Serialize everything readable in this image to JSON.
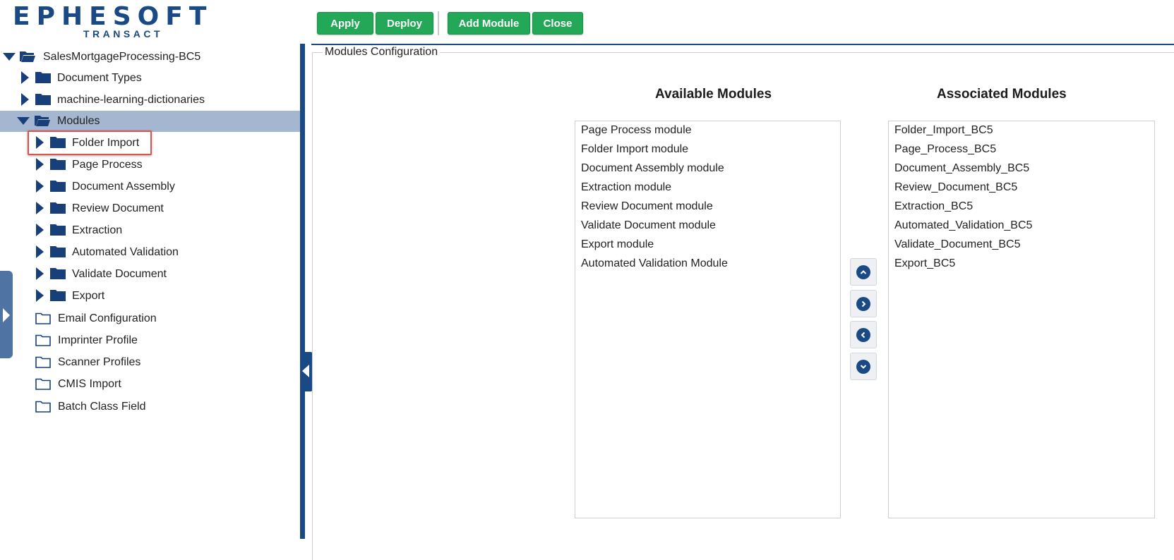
{
  "brand": {
    "name": "EPHESOFT",
    "sub": "TRANSACT"
  },
  "toolbar": {
    "apply": "Apply",
    "deploy": "Deploy",
    "add_module": "Add Module",
    "close": "Close"
  },
  "tree": {
    "root": "SalesMortgageProcessing-BC5",
    "document_types": "Document Types",
    "ml_dictionaries": "machine-learning-dictionaries",
    "modules": "Modules",
    "module_items": [
      "Folder Import",
      "Page Process",
      "Document Assembly",
      "Review Document",
      "Extraction",
      "Automated Validation",
      "Validate Document",
      "Export"
    ],
    "other_items": [
      "Email Configuration",
      "Imprinter Profile",
      "Scanner Profiles",
      "CMIS Import",
      "Batch Class Field"
    ]
  },
  "main": {
    "legend": "Modules Configuration",
    "available_title": "Available Modules",
    "associated_title": "Associated Modules",
    "available": [
      "Page Process module",
      "Folder Import module",
      "Document Assembly module",
      "Extraction module",
      "Review Document module",
      "Validate Document module",
      "Export module",
      "Automated Validation Module"
    ],
    "associated": [
      "Folder_Import_BC5",
      "Page_Process_BC5",
      "Document_Assembly_BC5",
      "Review_Document_BC5",
      "Extraction_BC5",
      "Automated_Validation_BC5",
      "Validate_Document_BC5",
      "Export_BC5"
    ]
  },
  "move_buttons": [
    "chevron-up-icon",
    "chevron-right-icon",
    "chevron-left-icon",
    "chevron-down-icon"
  ],
  "colors": {
    "brand_blue": "#1a4a86",
    "button_green": "#22a856",
    "selected_row": "#a4b6d0",
    "highlight_red": "#d9534f"
  }
}
